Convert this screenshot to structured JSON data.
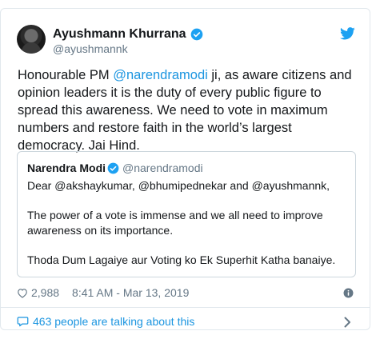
{
  "tweet": {
    "author_name": "Ayushmann Khurrana",
    "author_handle": "@ayushmannk",
    "text_parts": [
      "Honourable PM ",
      "@narendramodi",
      " ji, as aware citizens and opinion leaders it is the duty of every public figure to spread this awareness. We need to vote in maximum numbers and restore faith in the world’s largest democracy. Jai Hind."
    ],
    "likes": "2,988",
    "timestamp": "8:41 AM - Mar 13, 2019"
  },
  "quoted_tweet": {
    "author_name": "Narendra Modi",
    "author_handle": "@narendramodi",
    "paragraphs": [
      "Dear @akshaykumar, @bhumipednekar and @ayushmannk,",
      "The power of a vote is immense and we all need to improve awareness on its importance.",
      "Thoda Dum Lagaiye aur Voting ko Ek Superhit Katha banaiye."
    ]
  },
  "footer": {
    "talking_label": "463 people are talking about this"
  },
  "colors": {
    "accent": "#1b95e0",
    "verified": "#1da1f2",
    "muted": "#657786",
    "border": "#e1e8ed"
  },
  "icons": [
    "verified-badge-icon",
    "twitter-bird-icon",
    "heart-icon",
    "info-icon",
    "speech-bubble-icon",
    "chevron-right-icon"
  ]
}
